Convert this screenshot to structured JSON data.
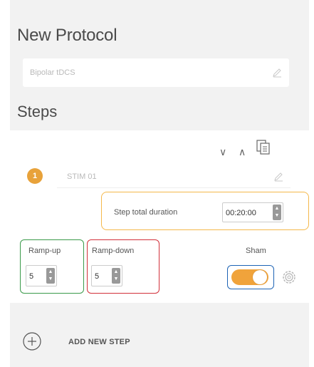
{
  "header": {
    "title": "New Protocol",
    "protocol_name": "Bipolar tDCS",
    "steps_title": "Steps"
  },
  "step": {
    "number": "1",
    "name": "STIM 01",
    "duration_label": "Step total duration",
    "duration_value": "00:20:00",
    "ramp_up_label": "Ramp-up",
    "ramp_up_value": "5",
    "ramp_down_label": "Ramp-down",
    "ramp_down_value": "5",
    "sham_label": "Sham",
    "sham_on": true,
    "move_down_glyph": "∨",
    "move_up_glyph": "∧"
  },
  "footer": {
    "add_step_label": "ADD NEW STEP"
  },
  "icons": {
    "pencil": "pencil-icon",
    "copy": "copy-icon",
    "gear": "gear-icon",
    "add": "plus-circle-icon"
  },
  "colors": {
    "accent": "#f0a33b",
    "highlight_duration": "#f5b84a",
    "highlight_rampup": "#3a9a4a",
    "highlight_rampdown": "#d2303a",
    "highlight_sham": "#1d63b5"
  }
}
